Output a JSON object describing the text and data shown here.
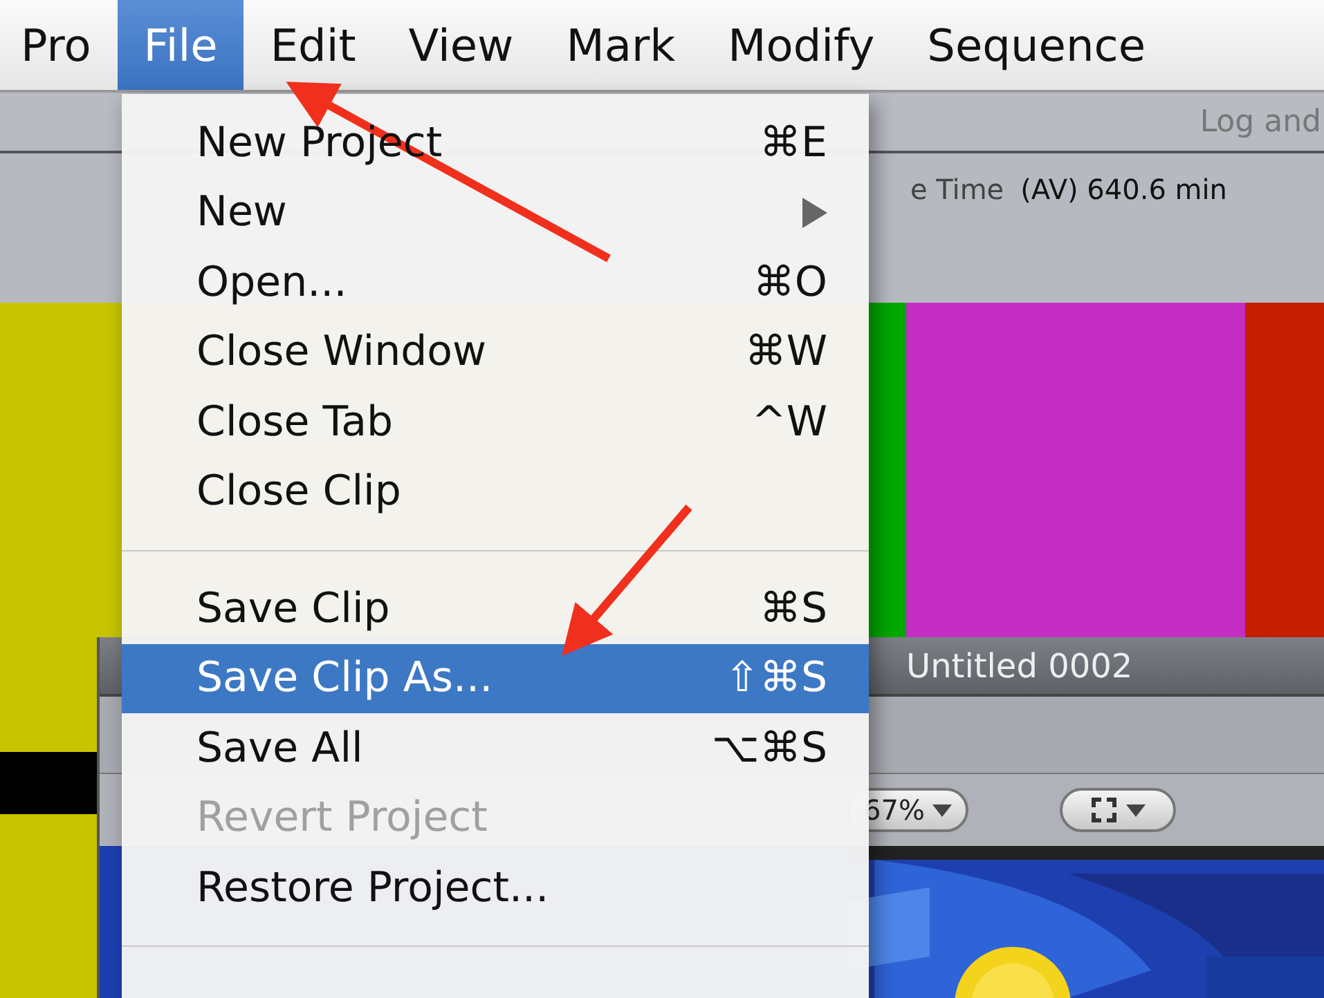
{
  "menu_bar": [
    {
      "label": "Pro",
      "selected": false
    },
    {
      "label": "File",
      "selected": true
    },
    {
      "label": "Edit",
      "selected": false
    },
    {
      "label": "View",
      "selected": false
    },
    {
      "label": "Mark",
      "selected": false
    },
    {
      "label": "Modify",
      "selected": false
    },
    {
      "label": "Sequence",
      "selected": false
    }
  ],
  "browser": {
    "tab": "Log and",
    "free_time_label": "e Time",
    "free_time_value": "(AV) 640.6 min"
  },
  "color_bars": [
    {
      "color": "#00a800"
    },
    {
      "color": "#c42ec2"
    },
    {
      "color": "#c41e00"
    }
  ],
  "viewer": {
    "title": "Untitled 0002",
    "zoom": "67%"
  },
  "file_menu": [
    {
      "kind": "item",
      "label": "New Project",
      "shortcut": "⌘E",
      "selected": false,
      "disabled": false,
      "submenu": false
    },
    {
      "kind": "item",
      "label": "New",
      "selected": false,
      "disabled": false,
      "submenu": true
    },
    {
      "kind": "item",
      "label": "Open...",
      "shortcut": "⌘O",
      "selected": false,
      "disabled": false,
      "submenu": false
    },
    {
      "kind": "item",
      "label": "Close Window",
      "shortcut": "⌘W",
      "selected": false,
      "disabled": false,
      "submenu": false
    },
    {
      "kind": "item",
      "label": "Close Tab",
      "shortcut": "^W",
      "selected": false,
      "disabled": false,
      "submenu": false
    },
    {
      "kind": "item",
      "label": "Close Clip",
      "selected": false,
      "disabled": false,
      "submenu": false
    },
    {
      "kind": "separator"
    },
    {
      "kind": "item",
      "label": "Save Clip",
      "shortcut": "⌘S",
      "selected": false,
      "disabled": false,
      "submenu": false
    },
    {
      "kind": "item",
      "label": "Save Clip As...",
      "shortcut": "⇧⌘S",
      "selected": true,
      "disabled": false,
      "submenu": false
    },
    {
      "kind": "item",
      "label": "Save All",
      "shortcut": "⌥⌘S",
      "selected": false,
      "disabled": false,
      "submenu": false
    },
    {
      "kind": "item",
      "label": "Revert Project",
      "selected": false,
      "disabled": true,
      "submenu": false
    },
    {
      "kind": "item",
      "label": "Restore Project...",
      "selected": false,
      "disabled": false,
      "submenu": false
    },
    {
      "kind": "separator"
    }
  ]
}
